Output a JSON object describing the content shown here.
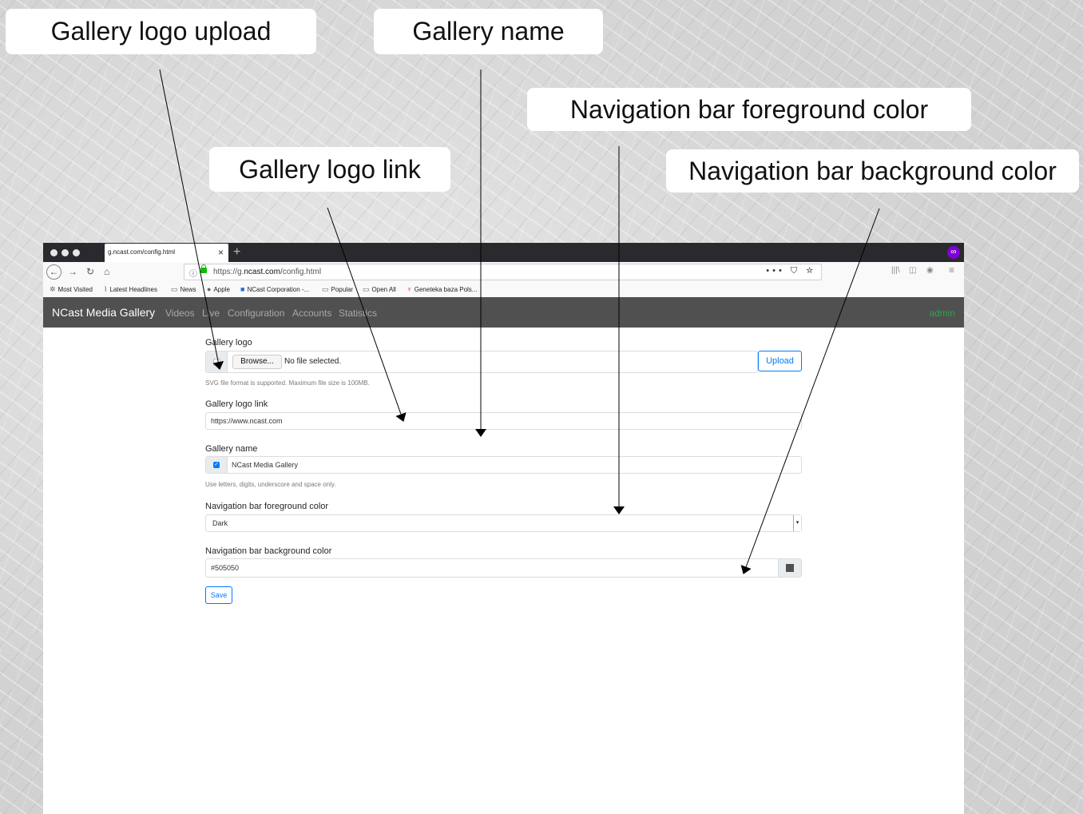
{
  "callouts": {
    "gallery_logo_upload": "Gallery logo upload",
    "gallery_name": "Gallery name",
    "nav_fg_color": "Navigation bar foreground color",
    "gallery_logo_link": "Gallery logo link",
    "nav_bg_color": "Navigation bar background color"
  },
  "browser": {
    "tab_title": "g.ncast.com/config.html",
    "tab_close": "×",
    "new_tab": "+",
    "private_icon": "∞",
    "url_prefix": "https://g.",
    "url_host": "ncast.com",
    "url_path": "/config.html",
    "url_actions": "••• ⛉ ☆",
    "bookmarks": [
      "Most Visited",
      "Latest Headlines",
      "News",
      "Apple",
      "NCast Corporation -...",
      "Popular",
      "Open All",
      "Geneteka baza Pols..."
    ]
  },
  "app": {
    "brand": "NCast Media Gallery",
    "nav": [
      "Videos",
      "Live",
      "Configuration",
      "Accounts",
      "Statistics"
    ],
    "user": "admin",
    "colors": {
      "navbar_bg": "#505050",
      "accent": "#007bff",
      "user": "#28a745"
    }
  },
  "form": {
    "logo_label": "Gallery logo",
    "browse_label": "Browse...",
    "no_file": "No file selected.",
    "upload_label": "Upload",
    "logo_help": "SVG file format is supported. Maximum file size is 100MB.",
    "logo_link_label": "Gallery logo link",
    "logo_link_value": "https://www.ncast.com",
    "name_label": "Gallery name",
    "name_value": "NCast Media Gallery",
    "name_help": "Use letters, digits, underscore and space only.",
    "fg_label": "Navigation bar foreground color",
    "fg_value": "Dark",
    "bg_label": "Navigation bar background color",
    "bg_value": "#505050",
    "save_label": "Save"
  }
}
